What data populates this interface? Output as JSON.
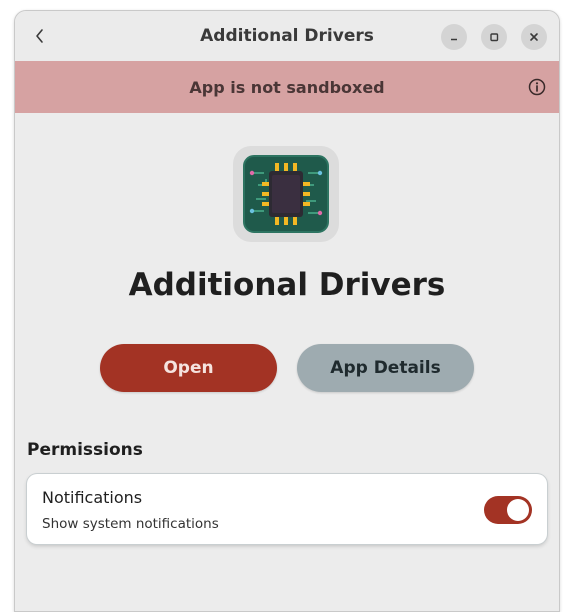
{
  "window": {
    "title": "Additional Drivers"
  },
  "banner": {
    "text": "App is not sandboxed"
  },
  "app": {
    "name": "Additional Drivers",
    "icon": "chip-icon"
  },
  "actions": {
    "open_label": "Open",
    "details_label": "App Details"
  },
  "permissions": {
    "section_title": "Permissions",
    "items": [
      {
        "title": "Notifications",
        "subtitle": "Show system notifications",
        "enabled": true
      }
    ]
  },
  "colors": {
    "accent": "#a33324",
    "banner": "#d6a2a2",
    "secondary_button": "#9eabb0",
    "window_bg": "#ececec"
  }
}
